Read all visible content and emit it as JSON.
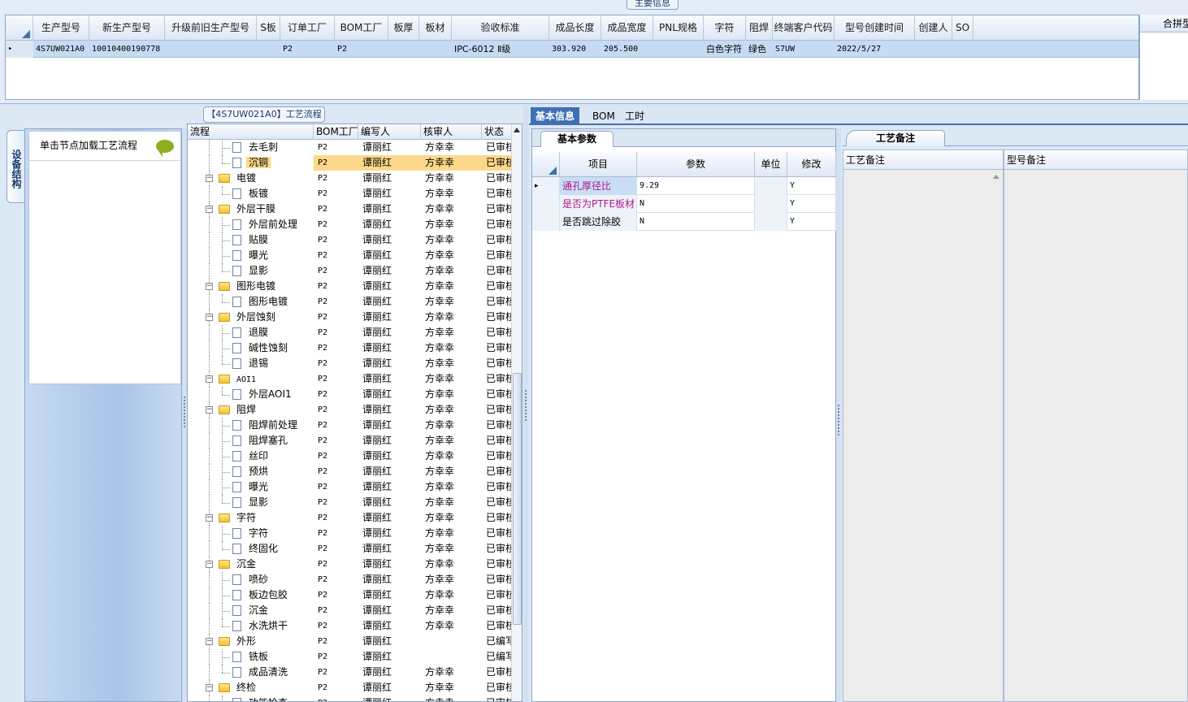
{
  "top": {
    "title": "主要信息",
    "side_header": "合拼型",
    "columns": [
      "生产型号",
      "新生产型号",
      "升级前旧生产型号",
      "S板",
      "订单工厂",
      "BOM工厂",
      "板厚",
      "板材",
      "验收标准",
      "成品长度",
      "成品宽度",
      "PNL规格",
      "字符",
      "阻焊",
      "终端客户代码",
      "型号创建时间",
      "创建人",
      "SO"
    ],
    "row": {
      "marker": "▸",
      "cells": [
        "4S7UW021A0",
        "10010400190778",
        "",
        "",
        "P2",
        "P2",
        "",
        "",
        "IPC-6012 Ⅱ级",
        "303.920",
        "205.500",
        "",
        "白色字符",
        "绿色",
        "S7UW",
        "2022/5/27",
        "",
        ""
      ]
    }
  },
  "left": {
    "flow_title": "【4S7UW021A0】工艺流程",
    "vertical_tab": "设备结构",
    "device_hint": "单击节点加载工艺流程",
    "tree_columns": [
      "流程",
      "BOM工厂",
      "编写人",
      "核审人",
      "状态"
    ],
    "tree_rows": [
      {
        "name": "去毛刺",
        "level": 1,
        "bom": "P2",
        "writer": "谭丽红",
        "reviewer": "方幸幸",
        "status": "已审核"
      },
      {
        "name": "沉铜",
        "level": 1,
        "bom": "P2",
        "writer": "谭丽红",
        "reviewer": "方幸幸",
        "status": "已审核",
        "selected": true
      },
      {
        "name": "电镀",
        "level": 0,
        "bom": "P2",
        "writer": "谭丽红",
        "reviewer": "方幸幸",
        "status": "已审核"
      },
      {
        "name": "板镀",
        "level": 1,
        "bom": "P2",
        "writer": "谭丽红",
        "reviewer": "方幸幸",
        "status": "已审核"
      },
      {
        "name": "外层干膜",
        "level": 0,
        "bom": "P2",
        "writer": "谭丽红",
        "reviewer": "方幸幸",
        "status": "已审核"
      },
      {
        "name": "外层前处理",
        "level": 1,
        "bom": "P2",
        "writer": "谭丽红",
        "reviewer": "方幸幸",
        "status": "已审核"
      },
      {
        "name": "贴膜",
        "level": 1,
        "bom": "P2",
        "writer": "谭丽红",
        "reviewer": "方幸幸",
        "status": "已审核"
      },
      {
        "name": "曝光",
        "level": 1,
        "bom": "P2",
        "writer": "谭丽红",
        "reviewer": "方幸幸",
        "status": "已审核"
      },
      {
        "name": "显影",
        "level": 1,
        "bom": "P2",
        "writer": "谭丽红",
        "reviewer": "方幸幸",
        "status": "已审核"
      },
      {
        "name": "图形电镀",
        "level": 0,
        "bom": "P2",
        "writer": "谭丽红",
        "reviewer": "方幸幸",
        "status": "已审核"
      },
      {
        "name": "图形电镀",
        "level": 1,
        "bom": "P2",
        "writer": "谭丽红",
        "reviewer": "方幸幸",
        "status": "已审核"
      },
      {
        "name": "外层蚀刻",
        "level": 0,
        "bom": "P2",
        "writer": "谭丽红",
        "reviewer": "方幸幸",
        "status": "已审核"
      },
      {
        "name": "退膜",
        "level": 1,
        "bom": "P2",
        "writer": "谭丽红",
        "reviewer": "方幸幸",
        "status": "已审核"
      },
      {
        "name": "碱性蚀刻",
        "level": 1,
        "bom": "P2",
        "writer": "谭丽红",
        "reviewer": "方幸幸",
        "status": "已审核"
      },
      {
        "name": "退锡",
        "level": 1,
        "bom": "P2",
        "writer": "谭丽红",
        "reviewer": "方幸幸",
        "status": "已审核"
      },
      {
        "name": "AOI1",
        "level": 0,
        "bom": "P2",
        "writer": "谭丽红",
        "reviewer": "方幸幸",
        "status": "已审核"
      },
      {
        "name": "外层AOI1",
        "level": 1,
        "bom": "P2",
        "writer": "谭丽红",
        "reviewer": "方幸幸",
        "status": "已审核"
      },
      {
        "name": "阻焊",
        "level": 0,
        "bom": "P2",
        "writer": "谭丽红",
        "reviewer": "方幸幸",
        "status": "已审核"
      },
      {
        "name": "阻焊前处理",
        "level": 1,
        "bom": "P2",
        "writer": "谭丽红",
        "reviewer": "方幸幸",
        "status": "已审核"
      },
      {
        "name": "阻焊塞孔",
        "level": 1,
        "bom": "P2",
        "writer": "谭丽红",
        "reviewer": "方幸幸",
        "status": "已审核"
      },
      {
        "name": "丝印",
        "level": 1,
        "bom": "P2",
        "writer": "谭丽红",
        "reviewer": "方幸幸",
        "status": "已审核"
      },
      {
        "name": "预烘",
        "level": 1,
        "bom": "P2",
        "writer": "谭丽红",
        "reviewer": "方幸幸",
        "status": "已审核"
      },
      {
        "name": "曝光",
        "level": 1,
        "bom": "P2",
        "writer": "谭丽红",
        "reviewer": "方幸幸",
        "status": "已审核"
      },
      {
        "name": "显影",
        "level": 1,
        "bom": "P2",
        "writer": "谭丽红",
        "reviewer": "方幸幸",
        "status": "已审核"
      },
      {
        "name": "字符",
        "level": 0,
        "bom": "P2",
        "writer": "谭丽红",
        "reviewer": "方幸幸",
        "status": "已审核"
      },
      {
        "name": "字符",
        "level": 1,
        "bom": "P2",
        "writer": "谭丽红",
        "reviewer": "方幸幸",
        "status": "已审核"
      },
      {
        "name": "终固化",
        "level": 1,
        "bom": "P2",
        "writer": "谭丽红",
        "reviewer": "方幸幸",
        "status": "已审核"
      },
      {
        "name": "沉金",
        "level": 0,
        "bom": "P2",
        "writer": "谭丽红",
        "reviewer": "方幸幸",
        "status": "已审核"
      },
      {
        "name": "喷砂",
        "level": 1,
        "bom": "P2",
        "writer": "谭丽红",
        "reviewer": "方幸幸",
        "status": "已审核"
      },
      {
        "name": "板边包胶",
        "level": 1,
        "bom": "P2",
        "writer": "谭丽红",
        "reviewer": "方幸幸",
        "status": "已审核"
      },
      {
        "name": "沉金",
        "level": 1,
        "bom": "P2",
        "writer": "谭丽红",
        "reviewer": "方幸幸",
        "status": "已审核"
      },
      {
        "name": "水洗烘干",
        "level": 1,
        "bom": "P2",
        "writer": "谭丽红",
        "reviewer": "方幸幸",
        "status": "已审核"
      },
      {
        "name": "外形",
        "level": 0,
        "bom": "P2",
        "writer": "谭丽红",
        "reviewer": "",
        "status": "已编写"
      },
      {
        "name": "铣板",
        "level": 1,
        "bom": "P2",
        "writer": "谭丽红",
        "reviewer": "",
        "status": "已编写"
      },
      {
        "name": "成品清洗",
        "level": 1,
        "bom": "P2",
        "writer": "谭丽红",
        "reviewer": "方幸幸",
        "status": "已审核"
      },
      {
        "name": "终检",
        "level": 0,
        "bom": "P2",
        "writer": "谭丽红",
        "reviewer": "方幸幸",
        "status": "已审核"
      },
      {
        "name": "功能检查",
        "level": 1,
        "bom": "P2",
        "writer": "谭丽红",
        "reviewer": "方幸幸",
        "status": "已审核"
      }
    ]
  },
  "right": {
    "tabs": [
      "基本信息",
      "BOM",
      "工时"
    ],
    "basic_tab": "基本参数",
    "param_columns": [
      "项目",
      "参数",
      "单位",
      "修改"
    ],
    "param_rows": [
      {
        "item": "通孔厚径比",
        "value": "9.29",
        "unit": "",
        "modify": "Y",
        "color": "#b0188a",
        "marker": "▸"
      },
      {
        "item": "是否为PTFE板材",
        "value": "N",
        "unit": "",
        "modify": "Y",
        "color": "#b0188a",
        "marker": ""
      },
      {
        "item": "是否跳过除胶",
        "value": "N",
        "unit": "",
        "modify": "Y",
        "color": "#000000",
        "marker": ""
      }
    ],
    "notes_tab": "工艺备注",
    "notes_columns": [
      "工艺备注",
      "型号备注"
    ]
  }
}
